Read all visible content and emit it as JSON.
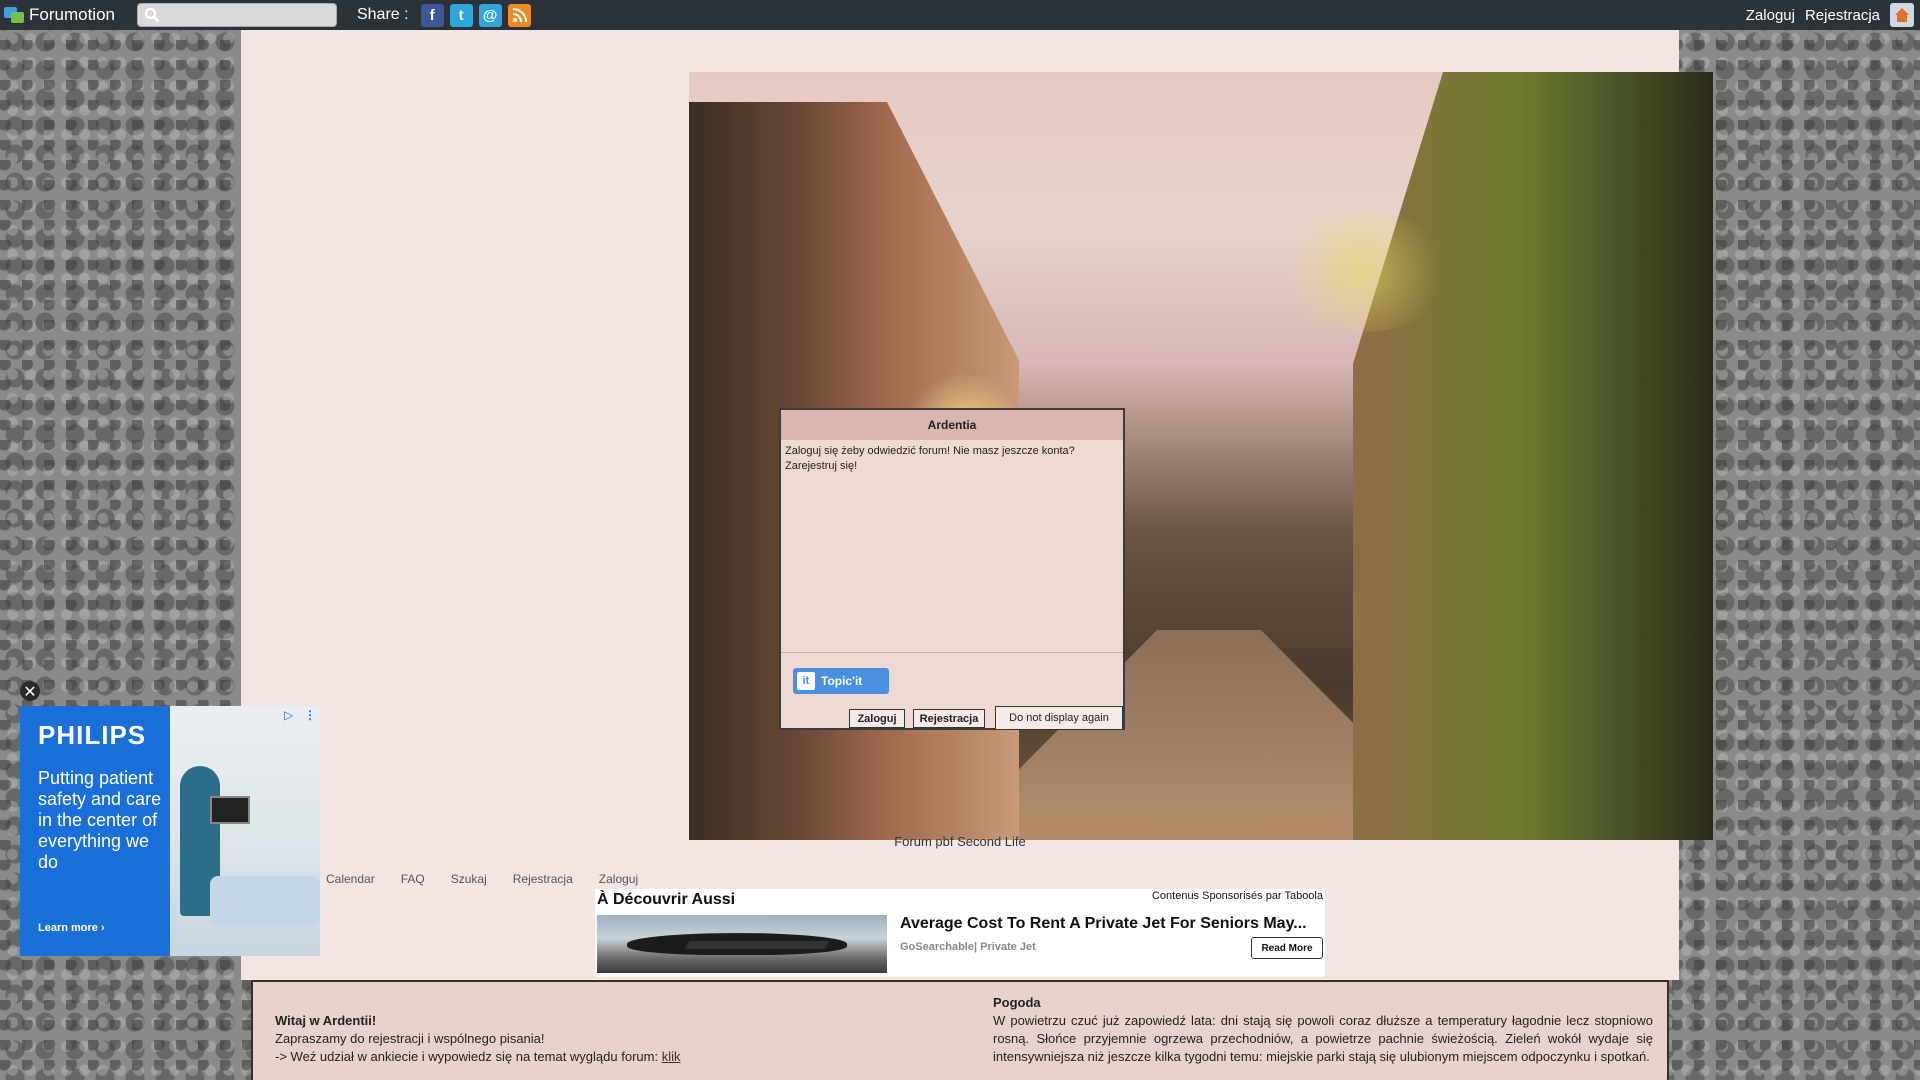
{
  "topbar": {
    "brand": "Forumotion",
    "search_placeholder": "",
    "share_label": "Share :",
    "share_icons": [
      "facebook-icon",
      "twitter-icon",
      "email-icon",
      "rss-icon"
    ],
    "login": "Zaloguj",
    "register": "Rejestracja"
  },
  "dialog": {
    "title": "Ardentia",
    "text": "Zaloguj się żeby odwiedzić forum! Nie masz jeszcze konta? Zarejestruj się!",
    "topicit": "Topic'it",
    "login_button": "Zaloguj",
    "register_button": "Rejestracja",
    "no_display_button": "Do not display again"
  },
  "forum": {
    "description": "Forum pbf Second Life",
    "nav": [
      "Calendar",
      "FAQ",
      "Szukaj",
      "Rejestracja",
      "Zaloguj"
    ]
  },
  "taboola": {
    "heading": "À Découvrir Aussi",
    "credit": "Contenus Sponsorisés par Taboola",
    "title": "Average Cost To Rent A Private Jet For Seniors May...",
    "source": "GoSearchable| Private Jet",
    "button": "Read More"
  },
  "welcome": {
    "title": "Witaj w Ardentii!",
    "line1": "Zapraszamy do rejestracji i wspólnego pisania!",
    "line2": "-> Weź udział w ankiecie i wypowiedz się na temat wyglądu forum: ",
    "link": "klik"
  },
  "weather": {
    "title": "Pogoda",
    "text": "W powietrzu czuć już zapowiedź lata: dni stają się powoli coraz dłuższe a temperatury łagodnie lecz stopniowo rosną. Słońce przyjemnie ogrzewa przechodniów, a powietrze pachnie świeżością. Zieleń wokół wydaje się intensywniejsza niż jeszcze kilka tygodni temu: miejskie parki stają się ulubionym miejscem odpoczynku i spotkań."
  },
  "ad": {
    "brand": "PHILIPS",
    "copy": "Putting patient safety and care in the center of everything we do",
    "cta": "Learn more ›",
    "close": "✕"
  }
}
